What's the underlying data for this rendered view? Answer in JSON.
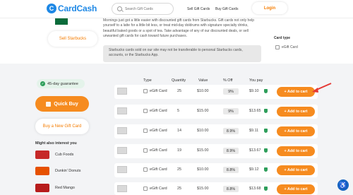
{
  "header": {
    "logo_text": "CardCash",
    "logo_mark": "C",
    "search_placeholder": "Search Gift Cards",
    "sell_link": "Sell Gift Cards",
    "buy_link": "Buy Gift Cards",
    "login_label": "Login"
  },
  "top": {
    "sell_button": "Sell Starbucks",
    "description": "Mornings just got a little easier with discounted gift cards from Starbucks. Gift cards not only help yourself to a latte for a little bit less, or treat mid-day doldrums with signature specialty drinks, beautiful baked goods or a spot of tea. Take advantage of any of our discounted deals, or sell unwanted gift cards for cash toward future purchases.",
    "notice": "Starbucks cards sold on our site may not be transferable to personal Starbucks cards, accounts, or the Starbucks App.",
    "card_type_label": "Card type",
    "card_type_value": "eGift Card"
  },
  "sidebar": {
    "guarantee": "45-day guarantee",
    "quick_buy": "Quick Buy",
    "new_gift": "Buy a New Gift Card",
    "might_label": "Might also interest you",
    "related": [
      {
        "name": "Cub Foods",
        "color": "#c62828"
      },
      {
        "name": "Dunkin' Donuts",
        "color": "#e65100"
      },
      {
        "name": "Red Mango",
        "color": "#b71c1c"
      }
    ]
  },
  "table": {
    "headers": {
      "type": "Type",
      "quantity": "Quantity",
      "value": "Value",
      "off": "% Off",
      "you_pay": "You pay"
    },
    "rows": [
      {
        "type": "eGift Card",
        "quantity": "25",
        "value": "$10.00",
        "off": "9%",
        "pay": "$9.10",
        "button": "+ Add to cart"
      },
      {
        "type": "eGift Card",
        "quantity": "5",
        "value": "$15.00",
        "off": "9%",
        "pay": "$13.65",
        "button": "+ Add to cart"
      },
      {
        "type": "eGift Card",
        "quantity": "14",
        "value": "$10.00",
        "off": "8.9%",
        "pay": "$9.11",
        "button": "+ Add to cart"
      },
      {
        "type": "eGift Card",
        "quantity": "19",
        "value": "$15.00",
        "off": "8.9%",
        "pay": "$13.67",
        "button": "+ Add to cart"
      },
      {
        "type": "eGift Card",
        "quantity": "25",
        "value": "$10.00",
        "off": "8.8%",
        "pay": "$9.12",
        "button": "+ Add to cart"
      },
      {
        "type": "eGift Card",
        "quantity": "25",
        "value": "$15.00",
        "off": "8.8%",
        "pay": "$13.68",
        "button": "+ Add to cart"
      }
    ]
  },
  "colors": {
    "accent": "#f68b1f",
    "brand": "#1e88e5",
    "success": "#2e9e5b"
  }
}
